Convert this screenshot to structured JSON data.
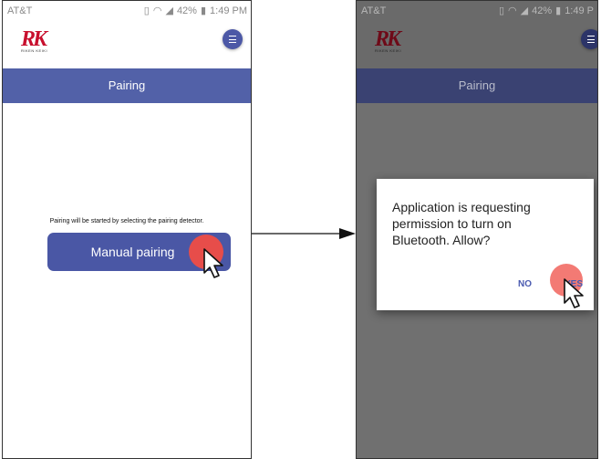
{
  "left_screen": {
    "status": {
      "carrier": "AT&T",
      "battery": "42%",
      "time": "1:49 PM"
    },
    "logo_text": "RK",
    "logo_sub": "RIKEN KEIKI",
    "title": "Pairing",
    "hint": "Pairing will be started by selecting the pairing detector.",
    "button_label": "Manual pairing"
  },
  "right_screen": {
    "status": {
      "carrier": "AT&T",
      "battery": "42%",
      "time": "1:49 P"
    },
    "logo_text": "RK",
    "logo_sub": "RIKEN KEIKI",
    "title": "Pairing",
    "dialog": {
      "message": "Application is requesting permission to turn on Bluetooth. Allow?",
      "no_label": "NO",
      "yes_label": "YES"
    }
  },
  "colors": {
    "primary": "#5261a8",
    "button": "#4a57a5",
    "tap": "#ef4d45",
    "accent_text": "#4a5ab0"
  }
}
